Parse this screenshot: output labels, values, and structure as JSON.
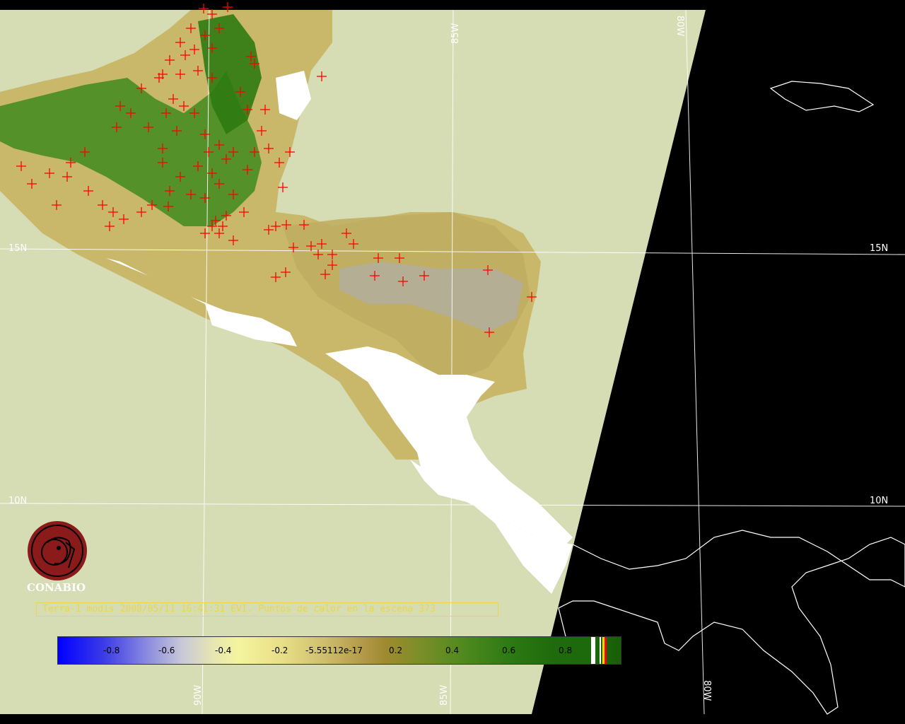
{
  "caption": "Terra-1 modis 2008/05/11 16:41:31 EVI. Puntos de calor en la escena 373",
  "logo": {
    "text": "CONABIO",
    "icon": "conabio-logo-icon"
  },
  "grid_labels": {
    "lat_15_left": "15N",
    "lat_15_right": "15N",
    "lat_10_left": "10N",
    "lat_10_right": "10N",
    "lon_85_top": "85W",
    "lon_80_top": "80W",
    "lon_90_bottom": "90W",
    "lon_85_bottom": "85W",
    "lon_80_bottom": "80W"
  },
  "colorbar": {
    "ticks": [
      "-0.8",
      "-0.6",
      "-0.4",
      "-0.2",
      "-5.55112e-17",
      "0.2",
      "0.4",
      "0.6",
      "0.8"
    ],
    "gradient_stops": [
      "#0000ff",
      "#c8c8d8",
      "#f4f4a0",
      "#b39a4a",
      "#2e7a14",
      "#1a5e08"
    ]
  },
  "colors": {
    "background_land_swath": "#d6dcb4",
    "no_data": "#000000",
    "fire_marker": "#ff0000",
    "caption": "#e8d84a",
    "logo": "#8b1a1a"
  }
}
